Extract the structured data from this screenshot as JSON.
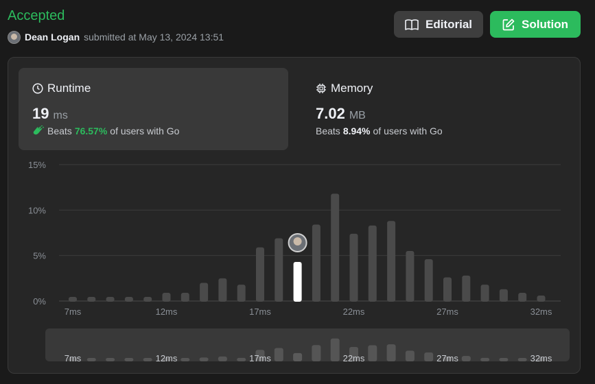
{
  "header": {
    "status": "Accepted",
    "user_name": "Dean Logan",
    "submitted_text": "submitted at May 13, 2024 13:51"
  },
  "buttons": {
    "editorial_label": "Editorial",
    "solution_label": "Solution"
  },
  "runtime": {
    "label": "Runtime",
    "value": "19",
    "unit": "ms",
    "beats_prefix": "Beats",
    "beats_pct": "76.57%",
    "beats_suffix": "of users with Go"
  },
  "memory": {
    "label": "Memory",
    "value": "7.02",
    "unit": "MB",
    "beats_prefix": "Beats",
    "beats_pct": "8.94%",
    "beats_suffix": "of users with Go"
  },
  "colors": {
    "accent_green": "#2cbb5d",
    "highlight_bar": "#ffffff",
    "bar": "#4a4a4a"
  },
  "chart_data": {
    "type": "bar",
    "title": "",
    "xlabel": "",
    "ylabel": "",
    "ylim": [
      0,
      15
    ],
    "yticks": [
      "0%",
      "5%",
      "10%",
      "15%"
    ],
    "xtick_labels": [
      "7ms",
      "12ms",
      "17ms",
      "22ms",
      "27ms",
      "32ms"
    ],
    "x": [
      7,
      8,
      9,
      10,
      11,
      12,
      13,
      14,
      15,
      16,
      17,
      18,
      19,
      20,
      21,
      22,
      23,
      24,
      25,
      26,
      27,
      28,
      29,
      30,
      31,
      32
    ],
    "values": [
      0.4,
      0.4,
      0.4,
      0.4,
      0.4,
      0.9,
      0.9,
      2.0,
      2.5,
      1.8,
      5.9,
      6.9,
      4.3,
      8.4,
      11.8,
      7.4,
      8.3,
      8.8,
      5.5,
      4.6,
      2.6,
      2.8,
      1.8,
      1.3,
      0.9,
      0.6
    ],
    "highlight_x": 19,
    "grid": true
  }
}
